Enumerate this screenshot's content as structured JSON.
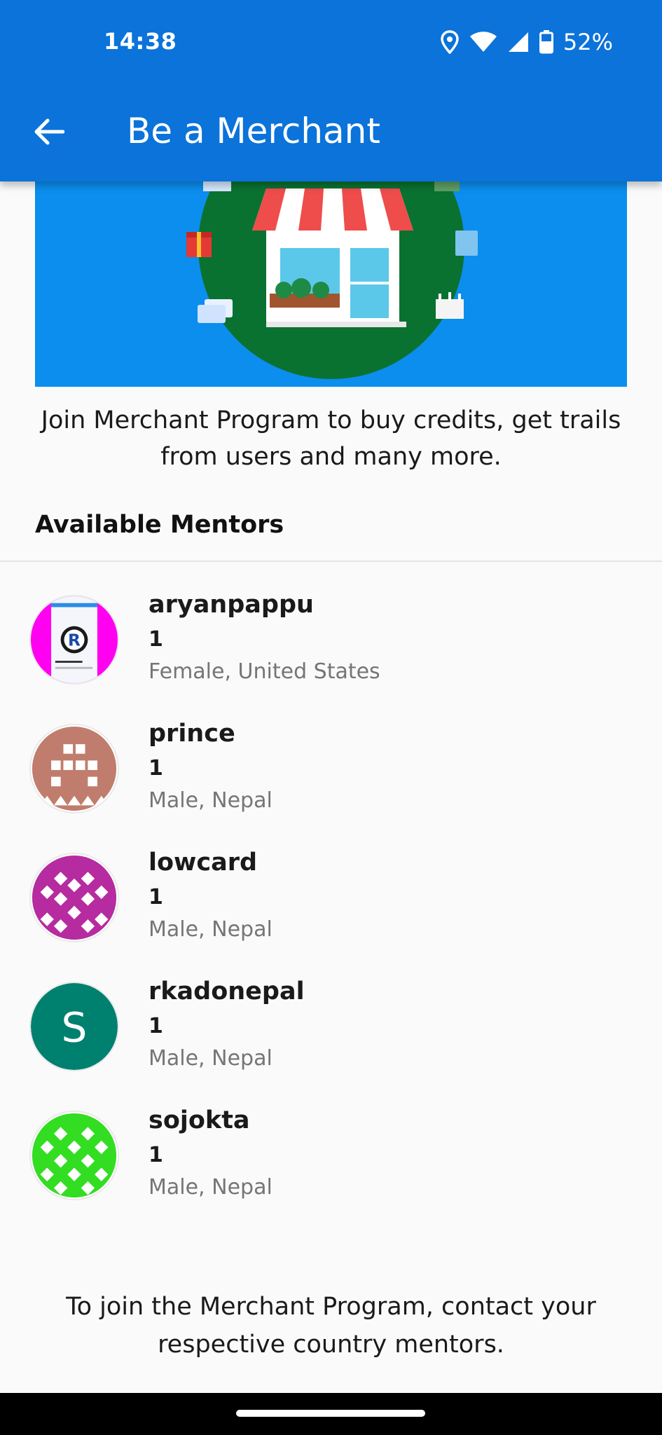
{
  "status_bar": {
    "time": "14:38",
    "battery": "52%"
  },
  "app_bar": {
    "title": "Be a Merchant",
    "back_icon": "arrow-left-icon"
  },
  "intro_text": "Join Merchant Program to buy credits, get trails from users and many more.",
  "mentors_section": {
    "title": "Available Mentors",
    "mentors": [
      {
        "name": "aryanpappu",
        "count": "1",
        "location": "Female, United States",
        "avatar": "screenshot-photo"
      },
      {
        "name": "prince",
        "count": "1",
        "location": "Male, Nepal",
        "avatar": "identicon-brown"
      },
      {
        "name": "lowcard",
        "count": "1",
        "location": "Male, Nepal",
        "avatar": "identicon-magenta"
      },
      {
        "name": "rkadonepal",
        "count": "1",
        "location": "Male, Nepal",
        "avatar": "letter-avatar",
        "avatar_letter": "S"
      },
      {
        "name": "sojokta",
        "count": "1",
        "location": "Male, Nepal",
        "avatar": "identicon-green"
      }
    ]
  },
  "footer_note": "To join the Merchant Program, contact your respective country mentors.",
  "colors": {
    "app_bar": "#0b73d9",
    "banner": "#0b8eee",
    "banner_circle": "#0a7230",
    "letter_avatar": "#00806f"
  }
}
